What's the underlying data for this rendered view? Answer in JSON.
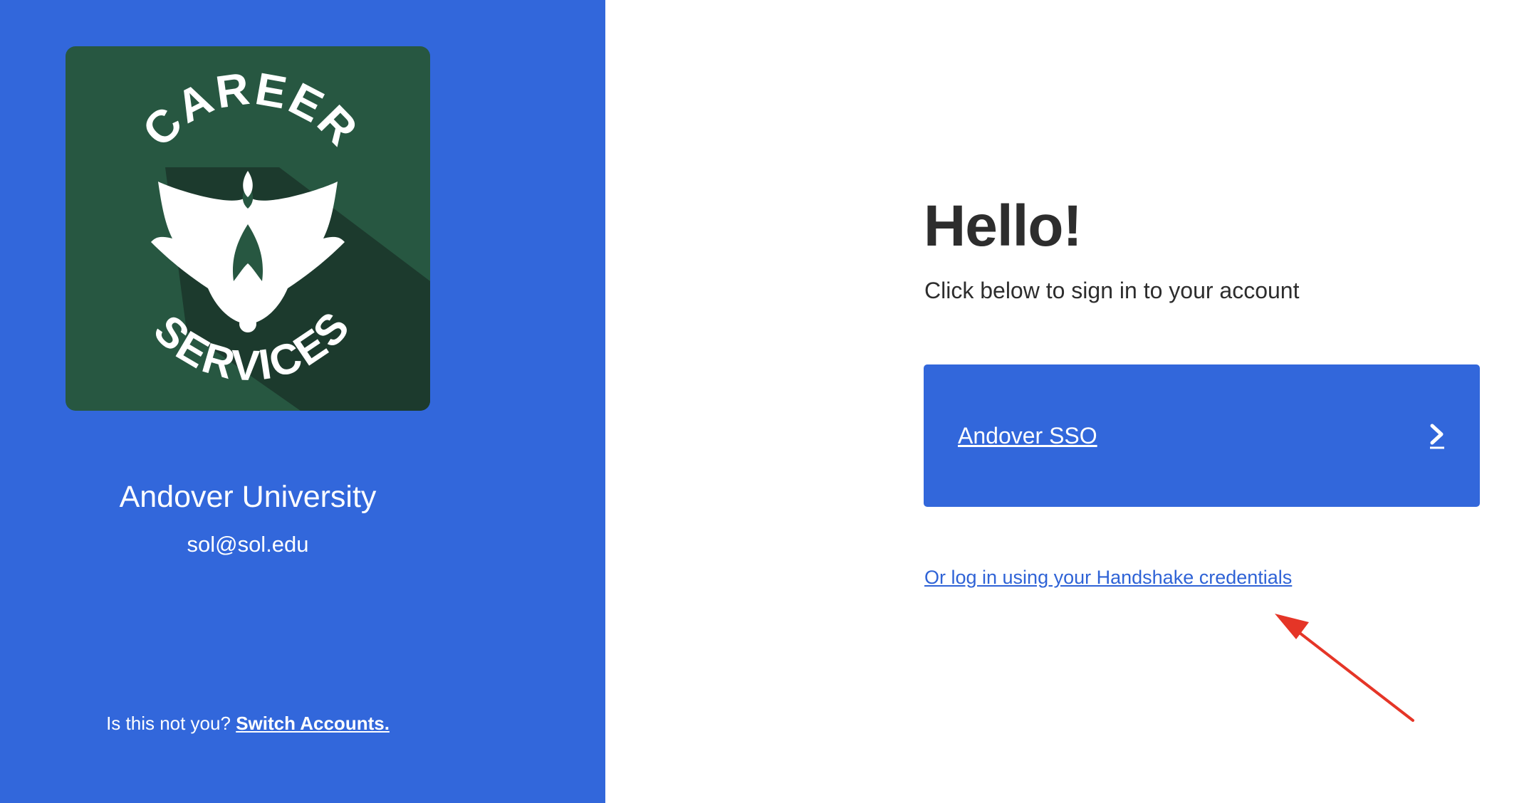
{
  "left_panel": {
    "logo": {
      "text_top": "CAREER",
      "text_bottom": "SERVICES",
      "tile_color": "#275741",
      "shadow_color": "#1c3a2d"
    },
    "school_name": "Andover University",
    "email": "sol@sol.edu",
    "switch_prompt": "Is this not you?",
    "switch_link": "Switch Accounts."
  },
  "main": {
    "heading": "Hello!",
    "subtitle": "Click below to sign in to your account",
    "sso_button_label": "Andover SSO",
    "sso_chevron_icon": "chevron-right-icon",
    "alt_login_link": "Or log in using your Handshake credentials"
  },
  "colors": {
    "brand_blue": "#3267db",
    "link_blue": "#2f63d6",
    "text_dark": "#2d2d2d",
    "annotation_red": "#e53527"
  }
}
